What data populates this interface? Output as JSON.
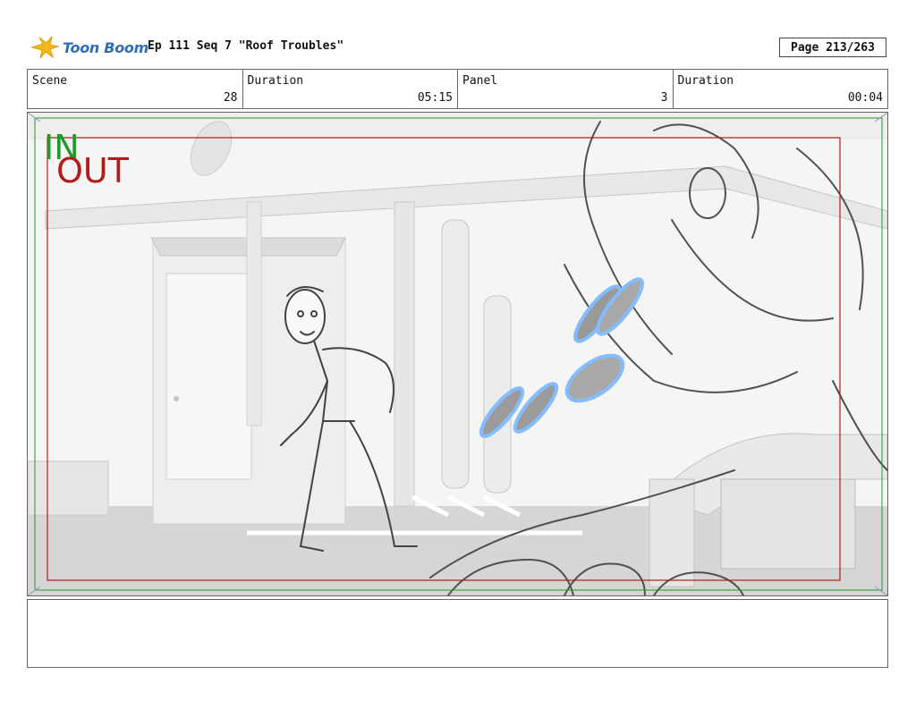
{
  "header": {
    "logo_text": "Toon Boom",
    "title": "Ep 111 Seq 7 \"Roof Troubles\"",
    "page": "Page 213/263"
  },
  "info": {
    "scene_label": "Scene",
    "scene_value": "28",
    "duration_label": "Duration",
    "duration_value": "05:15",
    "panel_label": "Panel",
    "panel_value": "3",
    "panel_duration_label": "Duration",
    "panel_duration_value": "00:04"
  },
  "frame": {
    "in_label": "IN",
    "out_label": "OUT",
    "in_color": "#1d9a2a",
    "out_color": "#b01b1b"
  },
  "notes": {
    "text": ""
  }
}
